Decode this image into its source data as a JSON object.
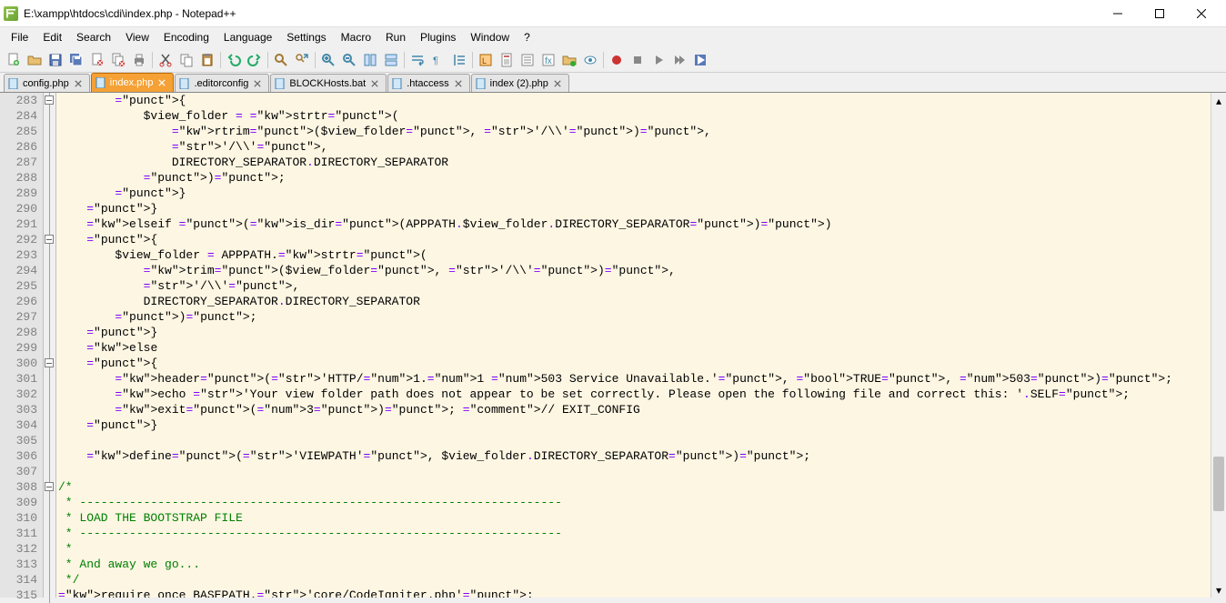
{
  "window": {
    "title": "E:\\xampp\\htdocs\\cdi\\index.php - Notepad++"
  },
  "menu": {
    "items": [
      "File",
      "Edit",
      "Search",
      "View",
      "Encoding",
      "Language",
      "Settings",
      "Macro",
      "Run",
      "Plugins",
      "Window",
      "?"
    ]
  },
  "toolbar": {
    "buttons": [
      {
        "name": "new-file-icon",
        "title": "New"
      },
      {
        "name": "open-file-icon",
        "title": "Open"
      },
      {
        "name": "save-icon",
        "title": "Save"
      },
      {
        "name": "save-all-icon",
        "title": "Save All"
      },
      {
        "name": "close-icon",
        "title": "Close"
      },
      {
        "name": "close-all-icon",
        "title": "Close All"
      },
      {
        "name": "print-icon",
        "title": "Print"
      },
      {
        "sep": true
      },
      {
        "name": "cut-icon",
        "title": "Cut"
      },
      {
        "name": "copy-icon",
        "title": "Copy"
      },
      {
        "name": "paste-icon",
        "title": "Paste"
      },
      {
        "sep": true
      },
      {
        "name": "undo-icon",
        "title": "Undo"
      },
      {
        "name": "redo-icon",
        "title": "Redo"
      },
      {
        "sep": true
      },
      {
        "name": "find-icon",
        "title": "Find"
      },
      {
        "name": "replace-icon",
        "title": "Replace"
      },
      {
        "sep": true
      },
      {
        "name": "zoom-in-icon",
        "title": "Zoom In"
      },
      {
        "name": "zoom-out-icon",
        "title": "Zoom Out"
      },
      {
        "name": "sync-v-icon",
        "title": "Sync Vertical"
      },
      {
        "name": "sync-h-icon",
        "title": "Sync Horizontal"
      },
      {
        "sep": true
      },
      {
        "name": "wordwrap-icon",
        "title": "Word Wrap"
      },
      {
        "name": "all-chars-icon",
        "title": "Show All Chars"
      },
      {
        "name": "indent-guide-icon",
        "title": "Indent Guide"
      },
      {
        "sep": true
      },
      {
        "name": "udl-icon",
        "title": "User Defined Language"
      },
      {
        "name": "doc-map-icon",
        "title": "Doc Map"
      },
      {
        "name": "doc-list-icon",
        "title": "Doc List"
      },
      {
        "name": "func-list-icon",
        "title": "Function List"
      },
      {
        "name": "folder-workspace-icon",
        "title": "Folder as Workspace"
      },
      {
        "name": "monitoring-icon",
        "title": "Monitoring"
      },
      {
        "sep": true
      },
      {
        "name": "record-icon",
        "title": "Start Recording"
      },
      {
        "name": "stop-icon",
        "title": "Stop Recording"
      },
      {
        "name": "play-icon",
        "title": "Playback"
      },
      {
        "name": "play-multi-icon",
        "title": "Run Multiple"
      },
      {
        "name": "save-macro-icon",
        "title": "Save Macro"
      }
    ]
  },
  "tabs": [
    {
      "label": "config.php",
      "active": false
    },
    {
      "label": "index.php",
      "active": true
    },
    {
      "label": ".editorconfig",
      "active": false
    },
    {
      "label": "BLOCKHosts.bat",
      "active": false
    },
    {
      "label": ".htaccess",
      "active": false
    },
    {
      "label": "index (2).php",
      "active": false
    }
  ],
  "editor": {
    "first_line": 283,
    "lines": [
      {
        "n": 283,
        "fold": "open",
        "raw": "        {"
      },
      {
        "n": 284,
        "raw": "            $view_folder = strtr("
      },
      {
        "n": 285,
        "raw": "                rtrim($view_folder, '/\\\\'),"
      },
      {
        "n": 286,
        "raw": "                '/\\\\',"
      },
      {
        "n": 287,
        "raw": "                DIRECTORY_SEPARATOR.DIRECTORY_SEPARATOR"
      },
      {
        "n": 288,
        "raw": "            );"
      },
      {
        "n": 289,
        "raw": "        }"
      },
      {
        "n": 290,
        "raw": "    }"
      },
      {
        "n": 291,
        "raw": "    elseif (is_dir(APPPATH.$view_folder.DIRECTORY_SEPARATOR))"
      },
      {
        "n": 292,
        "fold": "open",
        "raw": "    {"
      },
      {
        "n": 293,
        "raw": "        $view_folder = APPPATH.strtr("
      },
      {
        "n": 294,
        "raw": "            trim($view_folder, '/\\\\'),"
      },
      {
        "n": 295,
        "raw": "            '/\\\\',"
      },
      {
        "n": 296,
        "raw": "            DIRECTORY_SEPARATOR.DIRECTORY_SEPARATOR"
      },
      {
        "n": 297,
        "raw": "        );"
      },
      {
        "n": 298,
        "raw": "    }"
      },
      {
        "n": 299,
        "raw": "    else"
      },
      {
        "n": 300,
        "fold": "open",
        "raw": "    {"
      },
      {
        "n": 301,
        "raw": "        header('HTTP/1.1 503 Service Unavailable.', TRUE, 503);"
      },
      {
        "n": 302,
        "raw": "        echo 'Your view folder path does not appear to be set correctly. Please open the following file and correct this: '.SELF;"
      },
      {
        "n": 303,
        "raw": "        exit(3); // EXIT_CONFIG"
      },
      {
        "n": 304,
        "raw": "    }"
      },
      {
        "n": 305,
        "raw": ""
      },
      {
        "n": 306,
        "raw": "    define('VIEWPATH', $view_folder.DIRECTORY_SEPARATOR);"
      },
      {
        "n": 307,
        "raw": ""
      },
      {
        "n": 308,
        "fold": "open",
        "raw": "/*"
      },
      {
        "n": 309,
        "raw": " * --------------------------------------------------------------------"
      },
      {
        "n": 310,
        "raw": " * LOAD THE BOOTSTRAP FILE"
      },
      {
        "n": 311,
        "raw": " * --------------------------------------------------------------------"
      },
      {
        "n": 312,
        "raw": " *"
      },
      {
        "n": 313,
        "raw": " * And away we go..."
      },
      {
        "n": 314,
        "raw": " */"
      },
      {
        "n": 315,
        "raw": "require_once BASEPATH.'core/CodeIgniter.php';"
      }
    ]
  }
}
